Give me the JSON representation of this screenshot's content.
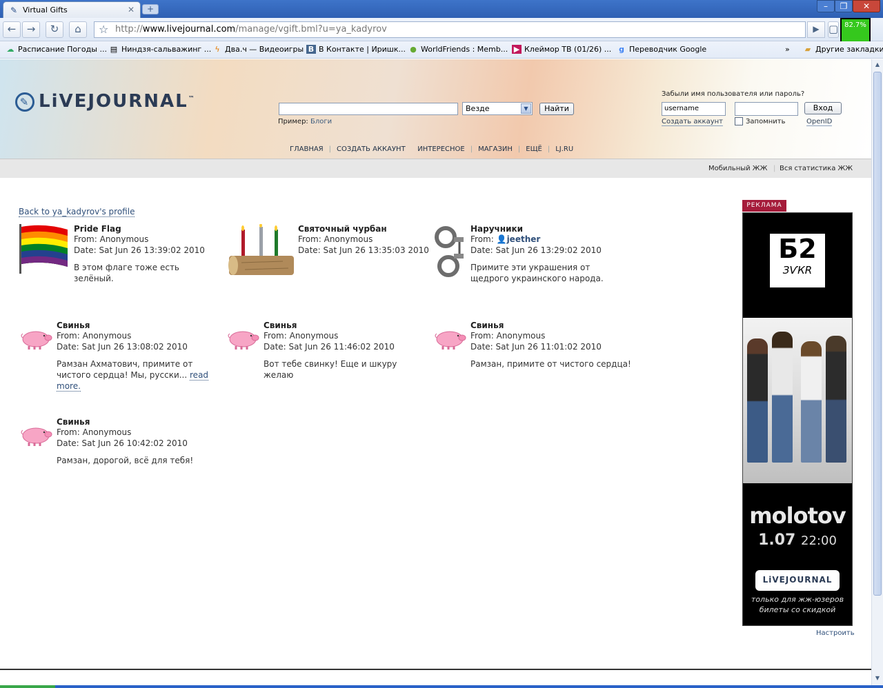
{
  "browser": {
    "tab_title": "Virtual Gifts",
    "url_prefix": "http://",
    "url_host": "www.livejournal.com",
    "url_path": "/manage/vgift.bml?u=ya_kadyrov",
    "meter": "82.7%",
    "bookmarks": [
      "Расписание Погоды ...",
      "Ниндзя-сальважинг ...",
      "Два.ч — Видеоигры",
      "В Контакте | Иришк...",
      "WorldFriends : Memb...",
      "Клеймор ТВ (01/26) ...",
      "Переводчик Google"
    ],
    "other_bookmarks": "Другие закладки"
  },
  "header": {
    "logo": "LiVEJOURNAL",
    "search_scope": "Везде",
    "search_button": "Найти",
    "example_label": "Пример:",
    "example_link": "Блоги",
    "nav": [
      "ГЛАВНАЯ",
      "СОЗДАТЬ АККАУНТ",
      "ИНТЕРЕСНОЕ",
      "МАГАЗИН",
      "ЕЩЁ",
      "LJ.RU"
    ],
    "login_question": "Забыли имя пользователя или пароль?",
    "username_value": "username",
    "login_button": "Вход",
    "create_account": "Создать аккаунт",
    "remember": "Запомнить",
    "openid": "OpenID"
  },
  "subbar": {
    "mobile": "Мобильный ЖЖ",
    "stats": "Вся статистика ЖЖ"
  },
  "main": {
    "back_link": "Back to ya_kadyrov's profile",
    "gifts": [
      {
        "name": "Pride Flag",
        "from_label": "From:",
        "from": "Anonymous",
        "date": "Date: Sat Jun 26 13:39:02 2010",
        "msg": "В этом флаге тоже есть зелёный."
      },
      {
        "name": "Святочный чурбан",
        "from_label": "From:",
        "from": "Anonymous",
        "date": "Date: Sat Jun 26 13:35:03 2010",
        "msg": ""
      },
      {
        "name": "Наручники",
        "from_label": "From:",
        "from": "jeether",
        "date": "Date: Sat Jun 26 13:29:02 2010",
        "msg": "Примите эти украшения от щедрого украинского народа."
      },
      {
        "name": "Свинья",
        "from_label": "From:",
        "from": "Anonymous",
        "date": "Date: Sat Jun 26 13:08:02 2010",
        "msg": "Рамзан Ахматович, примите от чистого сердца! Мы, русски...",
        "more": "read more."
      },
      {
        "name": "Свинья",
        "from_label": "From:",
        "from": "Anonymous",
        "date": "Date: Sat Jun 26 11:46:02 2010",
        "msg": "Вот тебе свинку! Еще и шкуру желаю"
      },
      {
        "name": "Свинья",
        "from_label": "From:",
        "from": "Anonymous",
        "date": "Date: Sat Jun 26 11:01:02 2010",
        "msg": "Рамзан, примите от чистого сердца!"
      },
      {
        "name": "Свинья",
        "from_label": "From:",
        "from": "Anonymous",
        "date": "Date: Sat Jun 26 10:42:02 2010",
        "msg": "Рамзан, дорогой, всё для тебя!"
      }
    ]
  },
  "ad": {
    "label": "РЕКЛАМА",
    "b2_big": "Б2",
    "b2_sub": "ЗѴКR",
    "band": "molotov",
    "date": "1.07",
    "time": "22:00",
    "lj": "LiVEJOURNAL",
    "promo_line1": "только для жж-юзеров",
    "promo_line2": "билеты со скидкой",
    "configure": "Настроить"
  },
  "colors": {
    "accent": "#2f4f7a",
    "ad_label": "#a51b3a",
    "meter": "#35c81d"
  }
}
